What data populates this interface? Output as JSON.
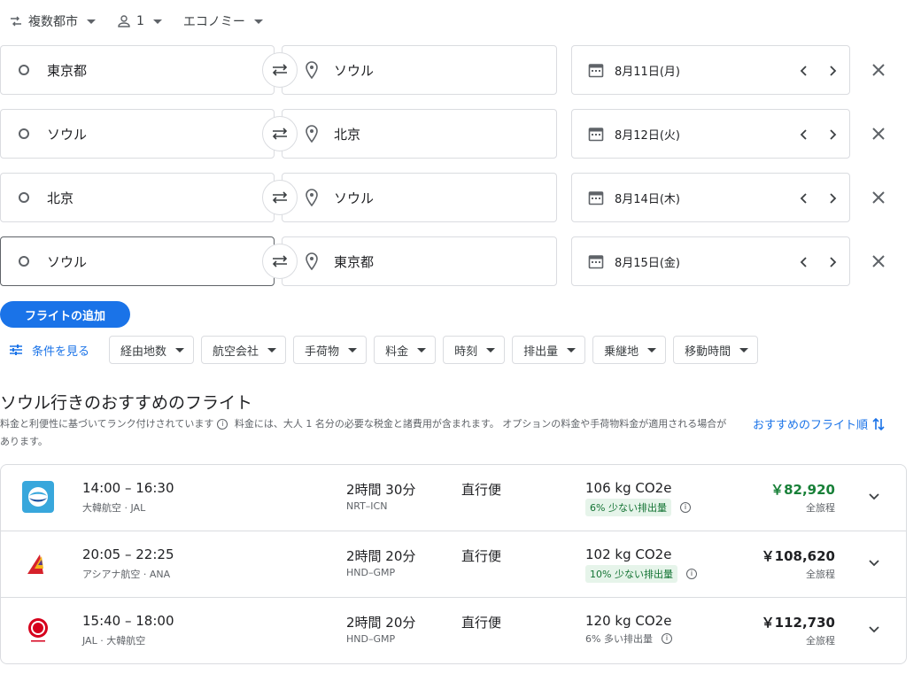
{
  "topbar": {
    "trip_type": "複数都市",
    "passengers": "1",
    "cabin": "エコノミー"
  },
  "legs": [
    {
      "origin": "東京都",
      "destination": "ソウル",
      "date": "8月11日(月)"
    },
    {
      "origin": "ソウル",
      "destination": "北京",
      "date": "8月12日(火)"
    },
    {
      "origin": "北京",
      "destination": "ソウル",
      "date": "8月14日(木)"
    },
    {
      "origin": "ソウル",
      "destination": "東京都",
      "date": "8月15日(金)"
    }
  ],
  "add_flight_label": "フライトの追加",
  "filters": {
    "all_label": "条件を見る",
    "chips": [
      "経由地数",
      "航空会社",
      "手荷物",
      "料金",
      "時刻",
      "排出量",
      "乗継地",
      "移動時間"
    ]
  },
  "results": {
    "heading": "ソウル行きのおすすめのフライト",
    "sub_ranked": "料金と利便性に基づいてランク付けされています",
    "sub_price": "料金には、大人 1 名分の必要な税金と諸費用が含まれます。 オプションの料金や手荷物料金が適用される場合があります。",
    "sort_label": "おすすめのフライト順",
    "flights": [
      {
        "logo": "korean-air-logo",
        "times": "14:00 – 16:30",
        "airline": "大韓航空 · JAL",
        "duration": "2時間 30分",
        "route": "NRT–ICN",
        "stops": "直行便",
        "co2": "106 kg CO2e",
        "emissions": "6% 少ない排出量",
        "emissions_good": true,
        "price": "￥82,920",
        "price_type": "全旅程"
      },
      {
        "logo": "asiana-logo",
        "times": "20:05 – 22:25",
        "airline": "アシアナ航空 · ANA",
        "duration": "2時間 20分",
        "route": "HND–GMP",
        "stops": "直行便",
        "co2": "102 kg CO2e",
        "emissions": "10% 少ない排出量",
        "emissions_good": true,
        "price": "￥108,620",
        "price_type": "全旅程"
      },
      {
        "logo": "jal-logo",
        "times": "15:40 – 18:00",
        "airline": "JAL · 大韓航空",
        "duration": "2時間 20分",
        "route": "HND–GMP",
        "stops": "直行便",
        "co2": "120 kg CO2e",
        "emissions": "6% 多い排出量",
        "emissions_good": false,
        "price": "￥112,730",
        "price_type": "全旅程"
      }
    ]
  },
  "colors": {
    "accent": "#1a73e8",
    "good_price": "#188038",
    "good_tag_bg": "#e6f4ea"
  }
}
